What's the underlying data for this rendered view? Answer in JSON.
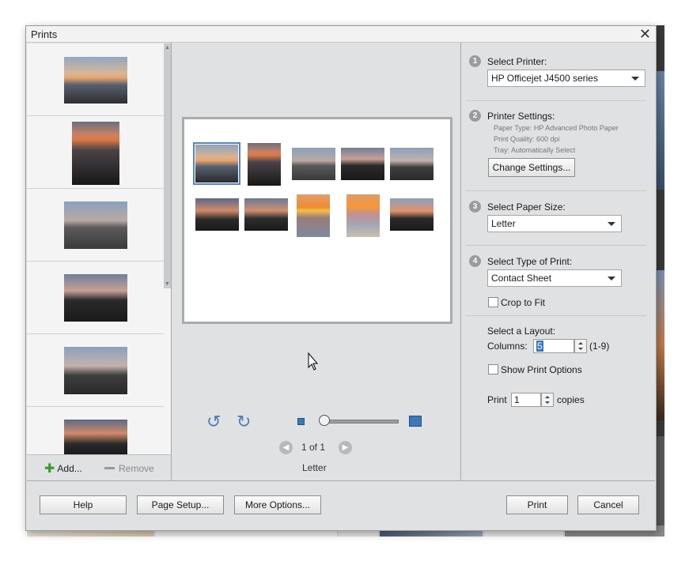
{
  "dialog": {
    "title": "Prints"
  },
  "thumbnails": [
    {
      "name": "thumb-1"
    },
    {
      "name": "thumb-2"
    },
    {
      "name": "thumb-3"
    },
    {
      "name": "thumb-4"
    },
    {
      "name": "thumb-5"
    },
    {
      "name": "thumb-6"
    }
  ],
  "left_panel": {
    "add_label": "Add...",
    "remove_label": "Remove"
  },
  "preview": {
    "page_info": "1 of 1",
    "paper_label": "Letter"
  },
  "right_panel": {
    "step1": {
      "num": "1",
      "label": "Select Printer:",
      "value": "HP Officejet J4500 series"
    },
    "step2": {
      "num": "2",
      "label": "Printer Settings:",
      "paper_type": "Paper Type: HP Advanced Photo Paper",
      "print_quality": "Print Quality: 600 dpi",
      "tray": "Tray:  Automatically Select",
      "change_button": "Change Settings..."
    },
    "step3": {
      "num": "3",
      "label": "Select Paper Size:",
      "value": "Letter"
    },
    "step4": {
      "num": "4",
      "label": "Select Type of Print:",
      "value": "Contact Sheet",
      "crop_label": "Crop to Fit"
    },
    "layout": {
      "label": "Select a Layout:",
      "columns_label": "Columns:",
      "columns_value": "5",
      "columns_range": "(1-9)",
      "show_options_label": "Show Print Options"
    },
    "copies": {
      "prefix": "Print",
      "value": "1",
      "suffix": "copies"
    }
  },
  "footer": {
    "help": "Help",
    "page_setup": "Page Setup...",
    "more_options": "More Options...",
    "print": "Print",
    "cancel": "Cancel"
  },
  "colors": {
    "accent": "#3d78b8",
    "selection": "#4f86c6",
    "add_icon": "#3a9a2a"
  },
  "icons": [
    "close-icon",
    "add-icon",
    "remove-icon",
    "rotate-left-icon",
    "rotate-right-icon",
    "zoom-small-icon",
    "zoom-large-icon",
    "prev-page-icon",
    "next-page-icon",
    "dropdown-caret-icon"
  ]
}
